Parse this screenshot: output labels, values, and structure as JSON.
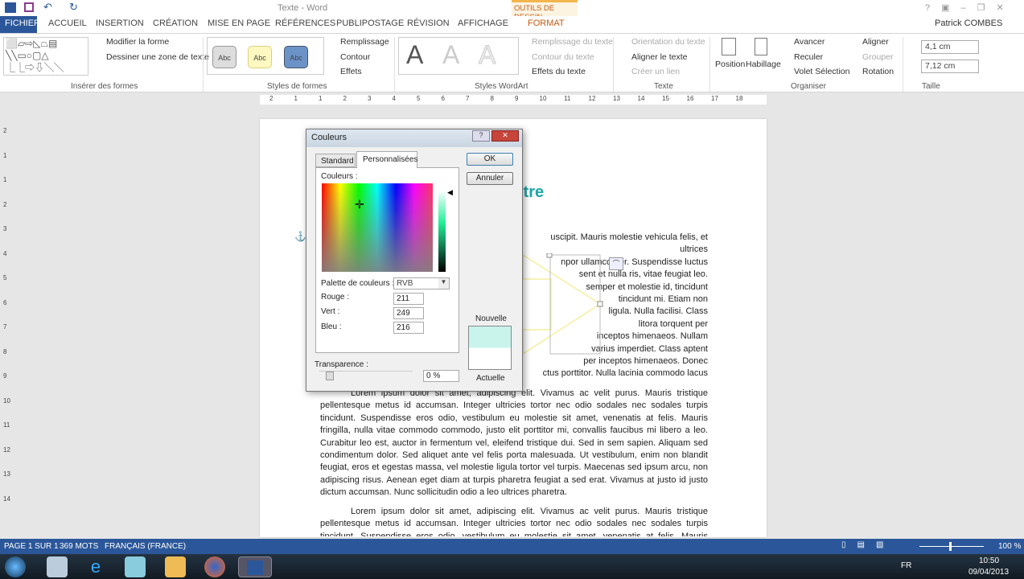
{
  "window": {
    "title": "Texte - Word",
    "context_tab_header": "OUTILS DE DESSIN",
    "user": "Patrick COMBES"
  },
  "tabs": [
    "FICHIER",
    "ACCUEIL",
    "INSERTION",
    "CRÉATION",
    "MISE EN PAGE",
    "RÉFÉRENCES",
    "PUBLIPOSTAGE",
    "RÉVISION",
    "AFFICHAGE",
    "FORMAT"
  ],
  "ribbon": {
    "insert_shapes": {
      "edit_shape": "Modifier la forme",
      "draw_textbox": "Dessiner une zone de texte",
      "label": "Insérer des formes"
    },
    "shape_styles": {
      "sample": "Abc",
      "fill": "Remplissage",
      "outline": "Contour",
      "effects": "Effets",
      "label": "Styles de formes"
    },
    "wordart": {
      "glyph": "A",
      "text_fill": "Remplissage du texte",
      "text_outline": "Contour du texte",
      "text_effects": "Effets du texte",
      "label": "Styles WordArt"
    },
    "text": {
      "direction": "Orientation du texte",
      "align": "Aligner le texte",
      "link": "Créer un lien",
      "label": "Texte"
    },
    "arrange": {
      "position": "Position",
      "wrap": "Habillage",
      "forward": "Avancer",
      "backward": "Reculer",
      "selection_pane": "Volet Sélection",
      "align": "Aligner",
      "group": "Grouper",
      "rotate": "Rotation",
      "label": "Organiser"
    },
    "size": {
      "height": "4,1 cm",
      "width": "7,12 cm",
      "label": "Taille"
    }
  },
  "ruler": {
    "h": [
      "2",
      "1",
      "1",
      "2",
      "3",
      "4",
      "5",
      "6",
      "7",
      "8",
      "9",
      "10",
      "11",
      "12",
      "13",
      "14",
      "15",
      "16",
      "17",
      "18"
    ],
    "v": [
      "2",
      "1",
      "1",
      "2",
      "3",
      "4",
      "5",
      "6",
      "7",
      "8",
      "9",
      "10",
      "11",
      "12",
      "13",
      "14"
    ]
  },
  "document": {
    "title": "itre",
    "p1_lines": [
      "uscipit. Mauris molestie vehicula felis, et ultrices",
      "npor ullamcorper. Suspendisse luctus",
      "sent et nulla ris, vitae feugiat leo.",
      "semper et molestie id, tincidunt",
      "tincidunt mi. Etiam non",
      "ligula. Nulla facilisi. Class",
      "litora torquent per",
      "inceptos himenaeos. Nullam",
      "varius imperdiet. Class aptent",
      "per inceptos himenaeos. Donec",
      "ctus porttitor. Nulla lacinia commodo lacus"
    ],
    "p2": "Lorem ipsum dolor sit amet, adipiscing elit. Vivamus ac velit purus. Mauris tristique pellentesque metus id accumsan. Integer ultricies tortor nec odio sodales nec sodales turpis tincidunt. Suspendisse eros odio, vestibulum eu molestie sit amet, venenatis at felis. Mauris fringilla, nulla vitae commodo commodo, justo elit porttitor mi, convallis faucibus mi libero a leo. Curabitur leo est, auctor in fermentum vel, eleifend tristique dui. Sed in sem sapien. Aliquam sed condimentum dolor. Sed aliquet ante vel felis porta malesuada. Ut vestibulum, enim non blandit feugiat, eros et egestas massa, vel molestie ligula tortor vel turpis. Maecenas sed ipsum arcu, non adipiscing risus. Aenean eget diam at turpis pharetra feugiat a sed erat. Vivamus at justo id justo dictum accumsan. Nunc sollicitudin odio a leo ultrices pharetra.",
    "p3": "Lorem ipsum dolor sit amet, adipiscing elit. Vivamus ac velit purus. Mauris tristique pellentesque metus id accumsan. Integer ultricies tortor nec odio sodales nec sodales turpis tincidunt. Suspendisse eros odio, vestibulum eu molestie sit amet, venenatis at felis. Mauris fringilla, nulla vitae"
  },
  "dialog": {
    "title": "Couleurs",
    "help": "?",
    "close": "✕",
    "tab_standard": "Standard",
    "tab_custom": "Personnalisées",
    "colors_label": "Couleurs :",
    "palette_label": "Palette de couleurs :",
    "palette_value": "RVB",
    "red_label": "Rouge :",
    "red": "211",
    "green_label": "Vert :",
    "green": "249",
    "blue_label": "Bleu :",
    "blue": "216",
    "transparency_label": "Transparence :",
    "transparency": "0 %",
    "ok": "OK",
    "cancel": "Annuler",
    "new_label": "Nouvelle",
    "current_label": "Actuelle",
    "new_color": "#d3f9d8",
    "display_new": "#c8f4ec",
    "current_color": "#ffffff"
  },
  "status": {
    "page": "PAGE 1 SUR 1",
    "words": "369 MOTS",
    "language": "FRANÇAIS (FRANCE)",
    "zoom": "100 %"
  },
  "taskbar": {
    "lang": "FR",
    "time": "10:50",
    "date": "09/04/2013"
  }
}
